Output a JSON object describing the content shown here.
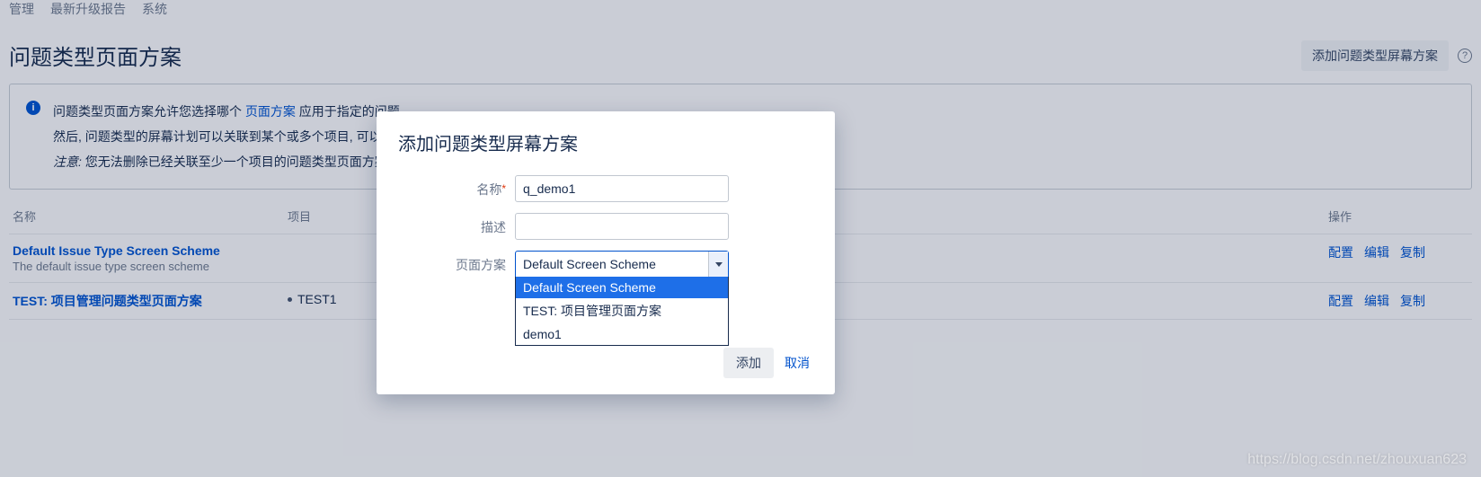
{
  "nav": {
    "item1": "管理",
    "item2": "最新升级报告",
    "item3": "系统"
  },
  "page": {
    "title": "问题类型页面方案",
    "addSchemeBtn": "添加问题类型屏幕方案"
  },
  "info": {
    "line1_pre": "问题类型页面方案允许您选择哪个 ",
    "line1_link": "页面方案",
    "line1_post": " 应用于指定的问题",
    "line2": "然后, 问题类型的屏幕计划可以关联到某个或多个项目, 可以指",
    "line3_pre": "注意:",
    "line3_post": " 您无法删除已经关联至少一个项目的问题类型页面方案。"
  },
  "table": {
    "header": {
      "name": "名称",
      "project": "项目",
      "ops": "操作"
    },
    "rows": [
      {
        "name": "Default Issue Type Screen Scheme",
        "desc": "The default issue type screen scheme",
        "projects": []
      },
      {
        "name": "TEST: 项目管理问题类型页面方案",
        "desc": "",
        "projects": [
          "TEST1"
        ]
      }
    ],
    "ops": {
      "config": "配置",
      "edit": "编辑",
      "copy": "复制"
    }
  },
  "modal": {
    "title": "添加问题类型屏幕方案",
    "labels": {
      "name": "名称",
      "desc": "描述",
      "scheme": "页面方案"
    },
    "values": {
      "name": "q_demo1",
      "desc": "",
      "schemeSelected": "Default Screen Scheme"
    },
    "options": [
      "Default Screen Scheme",
      "TEST: 项目管理页面方案",
      "demo1"
    ],
    "footer": {
      "submit": "添加",
      "cancel": "取消"
    }
  },
  "watermark": "https://blog.csdn.net/zhouxuan623"
}
